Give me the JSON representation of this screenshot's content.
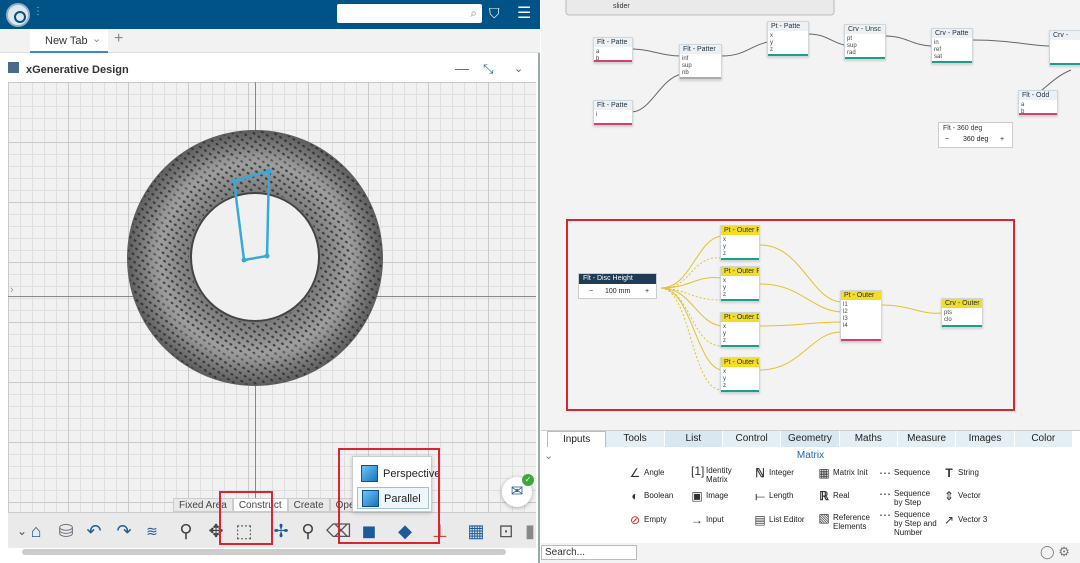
{
  "topbar": {
    "search_placeholder": "",
    "tag_icon": "tag-icon",
    "menu_icon": "hamburger-icon"
  },
  "tabs": {
    "active": "New Tab",
    "add": "+"
  },
  "app": {
    "title": "xGenerative Design"
  },
  "viewport_tabs": [
    "Fixed Area",
    "Construct",
    "Create",
    "Operate"
  ],
  "projection_menu": {
    "perspective": "Perspective",
    "parallel": "Parallel"
  },
  "right": {
    "nodes": {
      "n1": "Flt - Patte",
      "n2": "Flt - Patter",
      "n3": "Pt - Patte",
      "n4": "Crv - Unsc",
      "n5": "Crv - Patte",
      "n6": "Crv - ",
      "n7": "Flt - Patte",
      "n8": "Flt - Odd",
      "n9": "Flt - 360 deg",
      "disc": "Flt - Disc Height",
      "o1": "Pt - Outer R",
      "o2": "Pt - Outer R",
      "o3": "Pt - Outer Di",
      "o4": "Pt - Outer U",
      "outer": "Pt - Outer",
      "crv": "Crv - Outer I"
    },
    "ports": {
      "i": "i",
      "a": "a",
      "b": "b",
      "inf": "inf",
      "sup": "sup",
      "nb": "nb",
      "x": "x",
      "y": "y",
      "z": "z",
      "pt": "pt",
      "rad": "rad",
      "sup2": "sup",
      "in": "in",
      "ref": "ref",
      "sat": "sat",
      "l1": "l1",
      "l2": "l2",
      "l3": "l3",
      "l4": "l4",
      "pts": "pts",
      "clo": "clo"
    },
    "slider": {
      "minus": "−",
      "value": "360 deg",
      "plus": "+"
    },
    "disc": {
      "minus": "−",
      "value": "100 mm",
      "plus": "+"
    },
    "slider_top": "slider"
  },
  "categories": [
    "Inputs",
    "Tools",
    "List",
    "Control",
    "Geometry",
    "Maths",
    "Measure",
    "Images",
    "Color"
  ],
  "active_category": "Inputs",
  "section": "Matrix",
  "palette": [
    {
      "name": "Angle",
      "icon": "angle-icon"
    },
    {
      "name": "Boolean",
      "icon": "boolean-icon"
    },
    {
      "name": "Empty",
      "icon": "empty-icon"
    },
    {
      "name": "Identity Matrix",
      "icon": "identity-matrix-icon"
    },
    {
      "name": "Image",
      "icon": "image-icon"
    },
    {
      "name": "Input",
      "icon": "input-icon"
    },
    {
      "name": "Integer",
      "icon": "integer-icon"
    },
    {
      "name": "Length",
      "icon": "length-icon"
    },
    {
      "name": "List Editor",
      "icon": "list-editor-icon"
    },
    {
      "name": "Matrix Init",
      "icon": "matrix-init-icon"
    },
    {
      "name": "Real",
      "icon": "real-icon"
    },
    {
      "name": "Reference Elements",
      "icon": "reference-elements-icon"
    },
    {
      "name": "Sequence",
      "icon": "sequence-icon"
    },
    {
      "name": "Sequence by Step",
      "icon": "sequence-step-icon"
    },
    {
      "name": "Sequence by Step and Number",
      "icon": "sequence-step-number-icon"
    },
    {
      "name": "String",
      "icon": "string-icon"
    },
    {
      "name": "Vector",
      "icon": "vector-icon"
    },
    {
      "name": "Vector 3",
      "icon": "vector3-icon"
    }
  ],
  "search_label": "Search..."
}
